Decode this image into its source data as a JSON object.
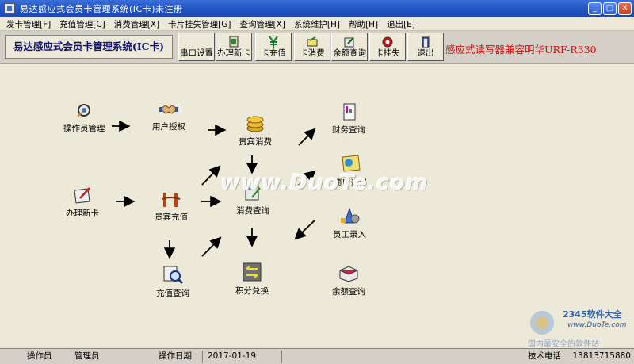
{
  "window": {
    "title": "易达感应式会员卡管理系统(IC卡)未注册",
    "minimize_glyph": "_",
    "maximize_glyph": "□",
    "close_glyph": "✕"
  },
  "menu": [
    {
      "label": "发卡管理[F]"
    },
    {
      "label": "充值管理[C]"
    },
    {
      "label": "消费管理[X]"
    },
    {
      "label": "卡片挂失管理[G]"
    },
    {
      "label": "查询管理[X]"
    },
    {
      "label": "系统维护[H]"
    },
    {
      "label": "帮助[H]"
    },
    {
      "label": "退出[E]"
    }
  ],
  "toolbar": {
    "system_title": "易达感应式会员卡管理系统(IC卡)",
    "buttons": [
      {
        "label": "串口设置",
        "icon": "serial-port-icon"
      },
      {
        "label": "办理新卡",
        "icon": "new-card-icon"
      },
      {
        "label": "卡充值",
        "icon": "yen-icon"
      },
      {
        "label": "卡消费",
        "icon": "card-consume-icon"
      },
      {
        "label": "余额查询",
        "icon": "balance-query-icon"
      },
      {
        "label": "卡挂失",
        "icon": "report-loss-icon"
      },
      {
        "label": "退出",
        "icon": "exit-icon"
      }
    ],
    "reader_note": "感应式读写器兼容明华URF-R330"
  },
  "flow": {
    "operator_mgmt": "操作员管理",
    "user_auth": "用户授权",
    "vip_consume": "贵宾消费",
    "finance_query": "财务查询",
    "new_card": "办理新卡",
    "vip_recharge": "贵宾充值",
    "consume_query": "消费查询",
    "item_setup": "项目设置",
    "staff_entry": "员工录入",
    "recharge_query": "充值查询",
    "points_exchange": "积分兑换",
    "balance_query": "余额查询"
  },
  "watermarks": {
    "center": "www.DuoTe.com",
    "logo_name": "2345软件大全",
    "logo_url": "www.DuoTe.com",
    "logo_sub": "国内最安全的软件站"
  },
  "status": {
    "operator_label": "操作员",
    "operator_value": "管理员",
    "date_label": "操作日期",
    "date_value": "2017-01-19",
    "support_label": "技术电话：",
    "support_phone": "13813715880"
  },
  "colors": {
    "title_bar": "#2456c8",
    "reader_note": "#d01010",
    "system_title": "#101070"
  }
}
